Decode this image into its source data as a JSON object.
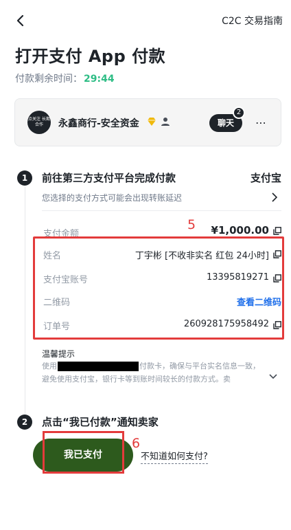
{
  "header": {
    "guide_link": "C2C 交易指南",
    "title": "打开支付 App 付款",
    "timer_label": "付款剩余时间：",
    "timer_value": "29:44"
  },
  "merchant": {
    "avatar_text": "点关注 长期合作",
    "name": "永鑫商行-安全资金",
    "chat_label": "聊天",
    "chat_badge": "2"
  },
  "step1": {
    "number": "1",
    "title": "前往第三方支付平台完成付款",
    "method": "支付宝",
    "note": "您选择的支付方式可能会出现转账延迟",
    "amount_label": "支付金额",
    "amount_value": "¥1,000.00",
    "rows": [
      {
        "label": "姓名",
        "value": "丁宇彬 [不收非实名 红包 24小时]"
      },
      {
        "label": "支付宝账号",
        "value": "13395819271"
      },
      {
        "label": "二维码",
        "value": "查看二维码"
      },
      {
        "label": "订单号",
        "value": "260928175958492"
      }
    ],
    "tips_title": "温馨提示",
    "tips_line1_pre": "使用",
    "tips_line1_post": "付款卡，确保与平台实名信息一致，",
    "tips_line2": "避免使用支付宝，银行卡等到账时间较长的付款方式。卖"
  },
  "step2": {
    "number": "2",
    "title": "点击“我已付款”通知卖家",
    "paid_button": "我已支付",
    "help_link": "不知道如何支付?"
  },
  "annotations": {
    "box5": "5",
    "box6": "6"
  },
  "colors": {
    "accent_green": "#2ebd85",
    "button_green": "#2d5a1d",
    "annotation_red": "#e33b3b",
    "link_blue": "#1f6fea"
  }
}
